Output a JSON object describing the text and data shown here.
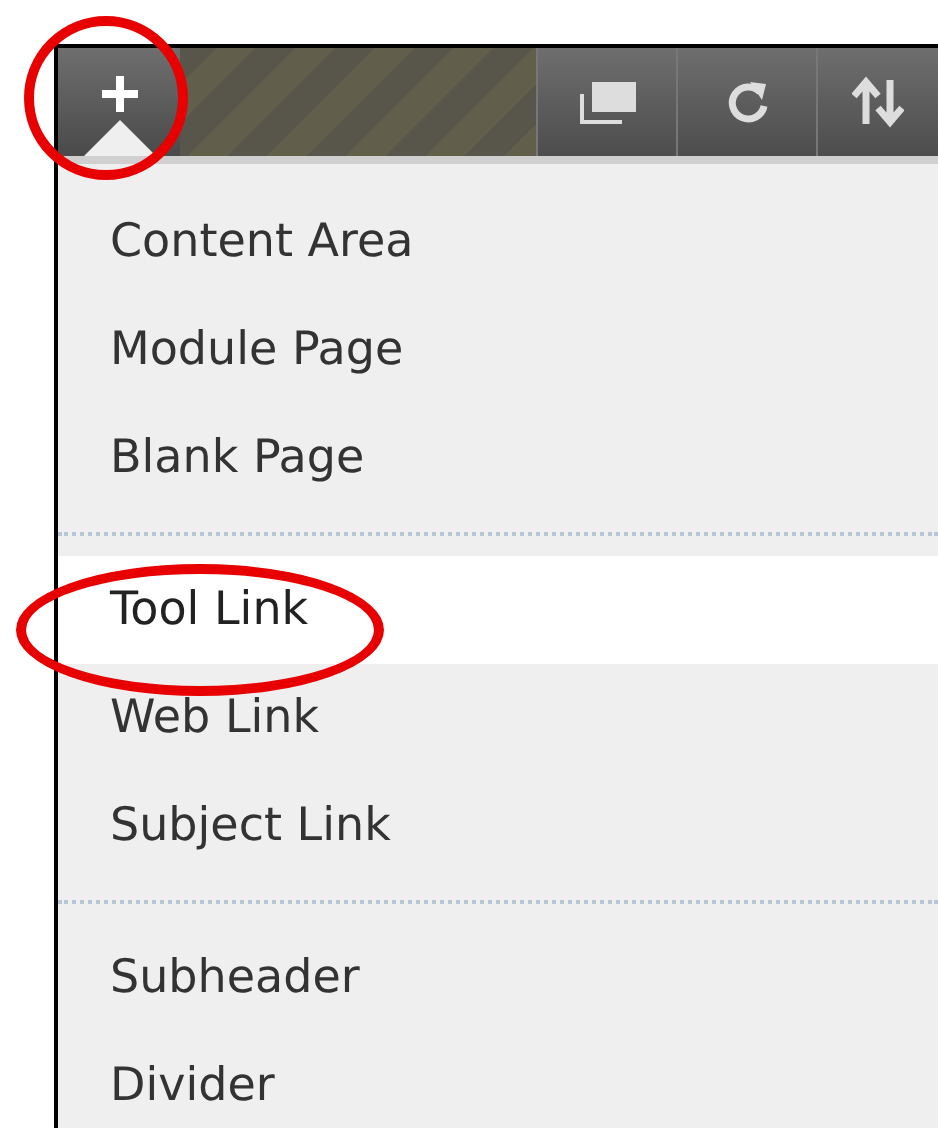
{
  "toolbar": {
    "add_button": {
      "expanded": true
    }
  },
  "menu": {
    "groups": [
      {
        "items": [
          {
            "label": "Content Area",
            "selected": false
          },
          {
            "label": "Module Page",
            "selected": false
          },
          {
            "label": "Blank Page",
            "selected": false
          }
        ]
      },
      {
        "items": [
          {
            "label": "Tool Link",
            "selected": true
          },
          {
            "label": "Web Link",
            "selected": false
          },
          {
            "label": "Subject Link",
            "selected": false
          }
        ]
      },
      {
        "items": [
          {
            "label": "Subheader",
            "selected": false
          },
          {
            "label": "Divider",
            "selected": false
          }
        ]
      }
    ]
  }
}
